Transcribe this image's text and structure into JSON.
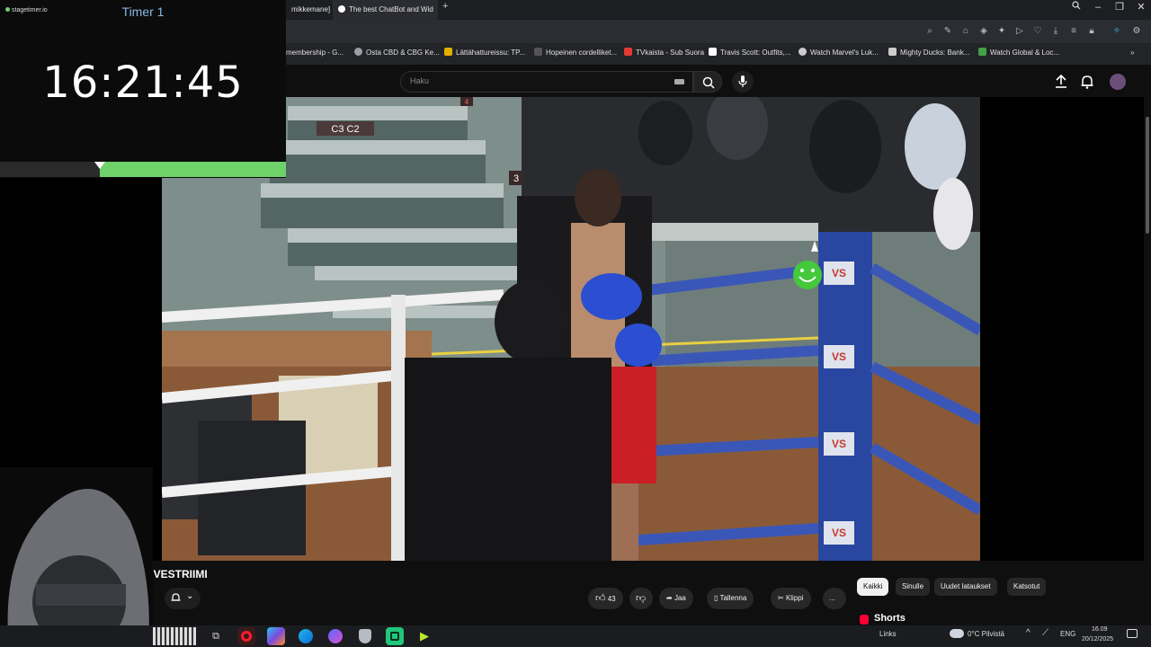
{
  "timer": {
    "brand": "stagetimer.io",
    "title": "Timer 1",
    "time": "16:21:45",
    "progress": 0.65
  },
  "tabs": [
    {
      "label": "mikkemane]"
    },
    {
      "label": "The best ChatBot and Wid"
    }
  ],
  "bookmarks": [
    {
      "label": "membership - G...",
      "color": "#888888"
    },
    {
      "label": "Osta CBD & CBG Ke...",
      "color": "#9aa0a6"
    },
    {
      "label": "Lättähattureissu: TP...",
      "color": "#e0b000"
    },
    {
      "label": "Hopeinen cordelliket...",
      "color": "#555555"
    },
    {
      "label": "TVkaista - Sub Suora",
      "color": "#e53935"
    },
    {
      "label": "Travis Scott: Outfits,...",
      "color": "#ffffff"
    },
    {
      "label": "Watch Marvel's Luk...",
      "color": "#cccccc"
    },
    {
      "label": "Mighty Ducks: Bank...",
      "color": "#cccccc"
    },
    {
      "label": "Watch Global & Loc...",
      "color": "#43a047"
    }
  ],
  "search": {
    "placeholder": "Haku"
  },
  "video": {
    "channel_label": "LIVESTRIIMI",
    "section_signs": [
      "C3 C2",
      "3",
      "4"
    ],
    "corner_brand": "VS",
    "likes": "43",
    "share_label": "Jaa",
    "save_label": "Tallenna",
    "clip_label": "Klippi",
    "more_label": "..."
  },
  "chips": [
    {
      "label": "Kaikki",
      "active": true
    },
    {
      "label": "Sinulle",
      "active": false
    },
    {
      "label": "Uudet lataukset",
      "active": false
    },
    {
      "label": "Katsotut",
      "active": false
    }
  ],
  "shorts_label": "Shorts",
  "taskbar": {
    "links_label": "Links",
    "weather": "0°C  Pilvistä",
    "lang": "ENG",
    "time": "16.09",
    "date": "20/12/2025"
  },
  "colors": {
    "timer_accent": "#6fd16a",
    "timer_title": "#87b9e6",
    "youtube_red": "#ff0033"
  }
}
